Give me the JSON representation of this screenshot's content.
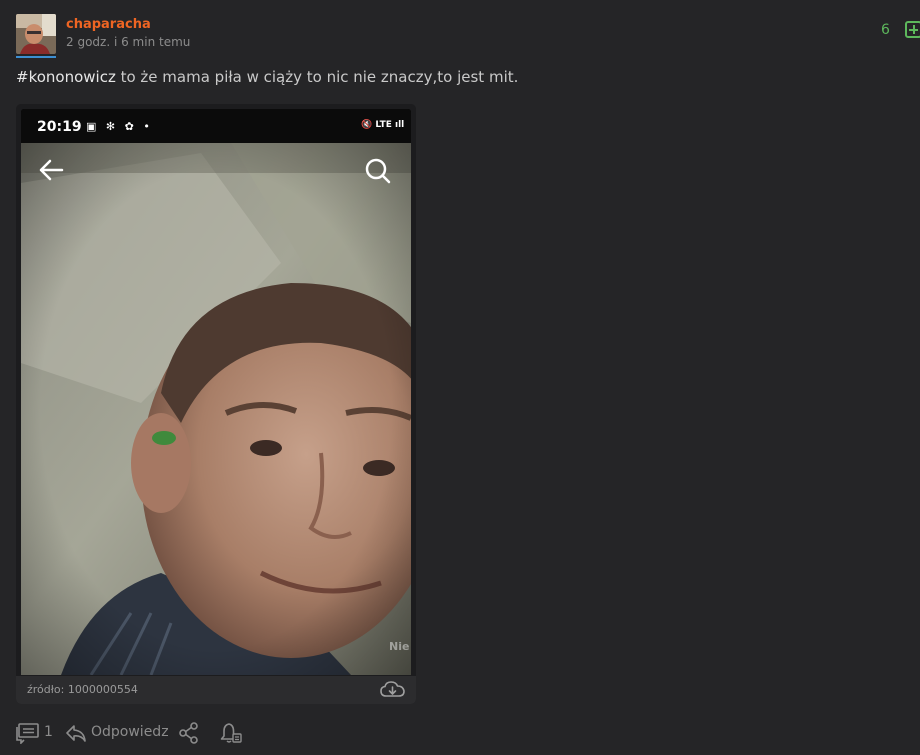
{
  "post": {
    "author": "chaparacha",
    "timestamp": "2 godz. i 6 min temu",
    "votes": "6",
    "hashtag": "#kononowicz",
    "text": " to że mama piła w ciąży to nic nie znaczy,to jest mit."
  },
  "embed": {
    "status_time": "20:19",
    "status_left_icons": "▣ ✻ ✿ •",
    "status_right_icons": "🔇 LTE ıll",
    "watermark": "Nie",
    "source": "źródło: 1000000554"
  },
  "actions": {
    "comments_count": "1",
    "reply_label": "Odpowiedz"
  },
  "colors": {
    "background": "#252527",
    "username": "#ee6523",
    "vote": "#5db85c",
    "muted": "#8c8c8c"
  },
  "icons": [
    "comments-icon",
    "reply-icon",
    "share-icon",
    "notification-bell-icon",
    "download-cloud-icon",
    "back-arrow-icon",
    "search-icon",
    "plus-icon"
  ]
}
